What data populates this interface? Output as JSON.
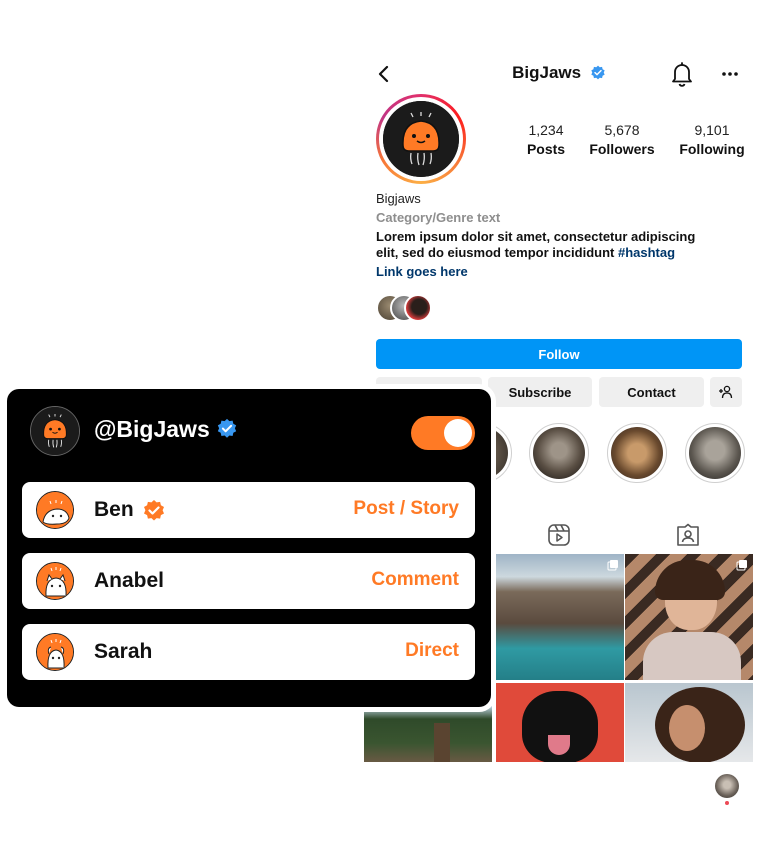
{
  "profile": {
    "username": "BigJaws",
    "stats": [
      {
        "value": "1,234",
        "label": "Posts"
      },
      {
        "value": "5,678",
        "label": "Followers"
      },
      {
        "value": "9,101",
        "label": "Following"
      }
    ],
    "bio": {
      "name": "Bigjaws",
      "category": "Category/Genre text",
      "text": "Lorem ipsum dolor sit amet, consectetur adipiscing elit, sed do eiusmod tempor incididunt",
      "hashtag": "#hashtag",
      "link": "Link goes here"
    },
    "buttons": {
      "follow": "Follow",
      "subscribe": "Subscribe",
      "contact": "Contact"
    }
  },
  "panel": {
    "handle": "@BigJaws",
    "toggle_on": true,
    "rows": [
      {
        "name": "Ben",
        "type": "Post / Story",
        "verified": true
      },
      {
        "name": "Anabel",
        "type": "Comment",
        "verified": false
      },
      {
        "name": "Sarah",
        "type": "Direct",
        "verified": false
      }
    ]
  },
  "colors": {
    "accent_orange": "#ff7a25",
    "instagram_blue": "#0095f6",
    "verified_blue": "#3897f0",
    "panel_bg": "#000000"
  },
  "icons": [
    "back-icon",
    "verified-icon",
    "bell-icon",
    "more-icon",
    "add-person-icon",
    "reels-icon",
    "tagged-icon",
    "multi-post-icon"
  ]
}
